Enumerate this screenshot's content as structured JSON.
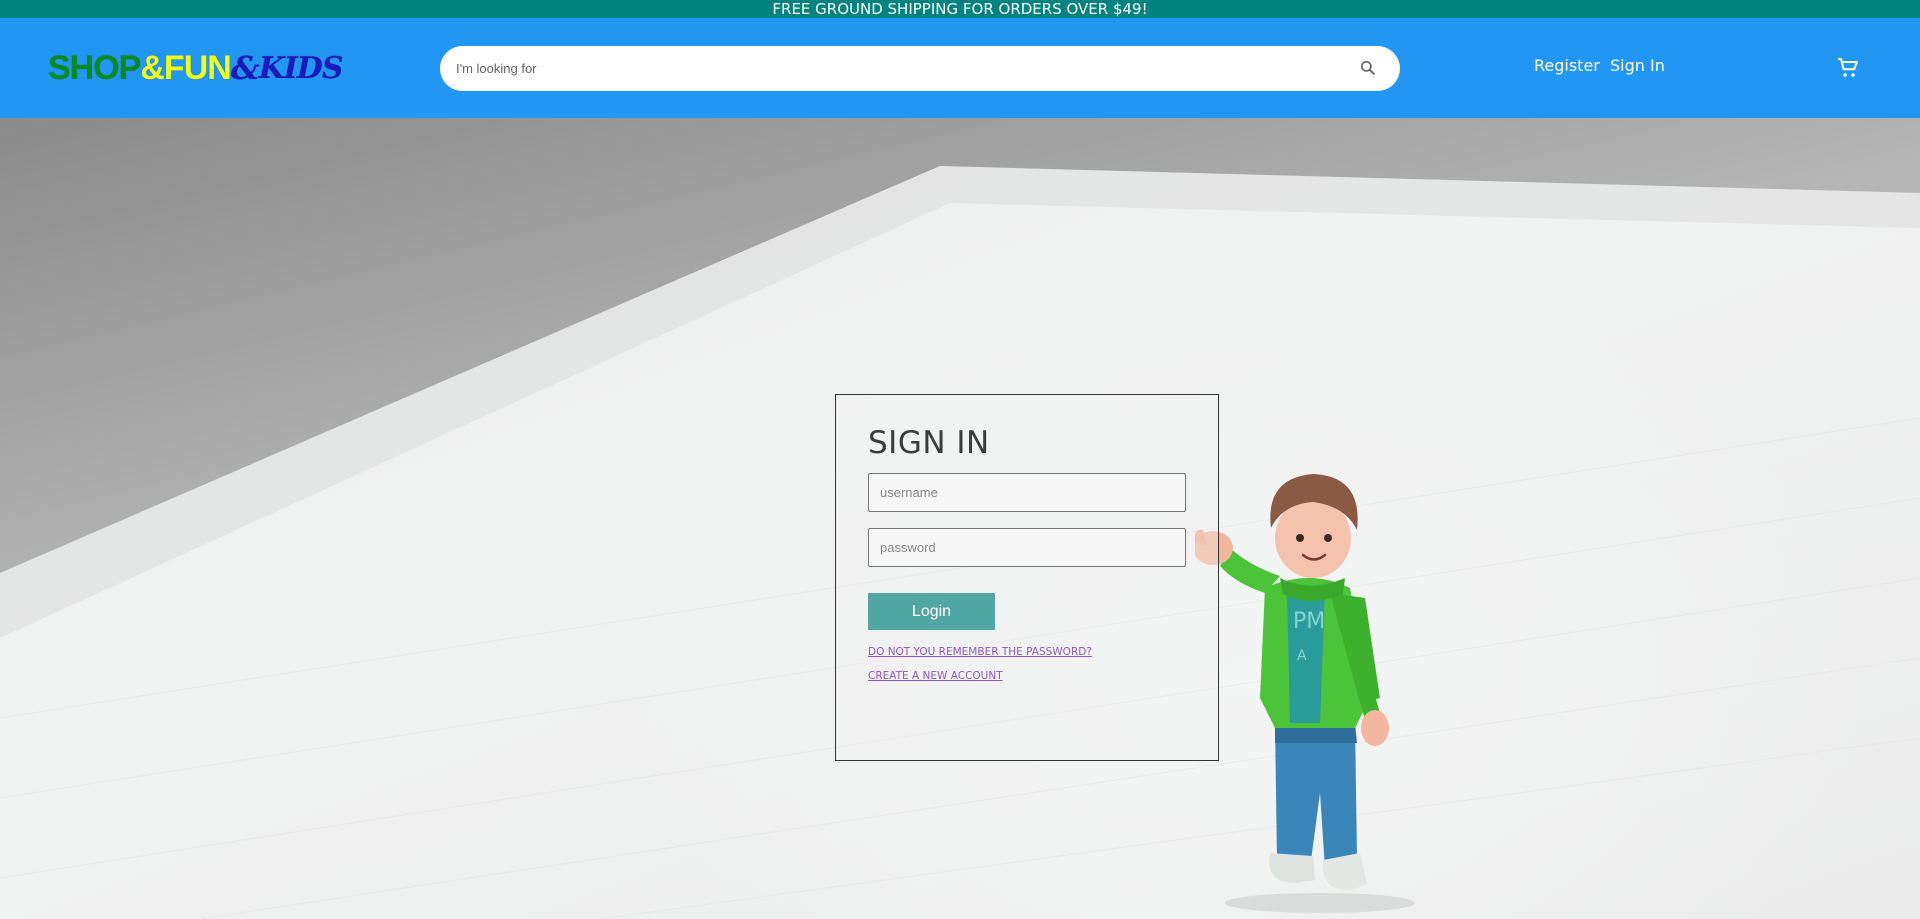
{
  "promo": {
    "text": "FREE GROUND SHIPPING FOR ORDERS OVER $49!"
  },
  "header": {
    "logo": {
      "part1": "SHOP",
      "part2": "&",
      "part3": "FUN",
      "part4": "&",
      "part5": "KIDS"
    },
    "search": {
      "placeholder": "I'm looking for",
      "icon": "search-icon"
    },
    "nav": {
      "register_label": "Register",
      "signin_label": "Sign In"
    },
    "cart_icon": "cart-icon"
  },
  "signin": {
    "title": "SIGN IN",
    "username_placeholder": "username",
    "password_placeholder": "password",
    "login_label": "Login",
    "forgot_link": "DO NOT YOU REMEMBER THE PASSWORD?",
    "create_link": "CREATE A NEW ACCOUNT"
  },
  "colors": {
    "promo_bg": "#00837f",
    "header_bg": "#2196f3",
    "login_button": "#4fa6a2",
    "link": "#8b5bb8"
  }
}
